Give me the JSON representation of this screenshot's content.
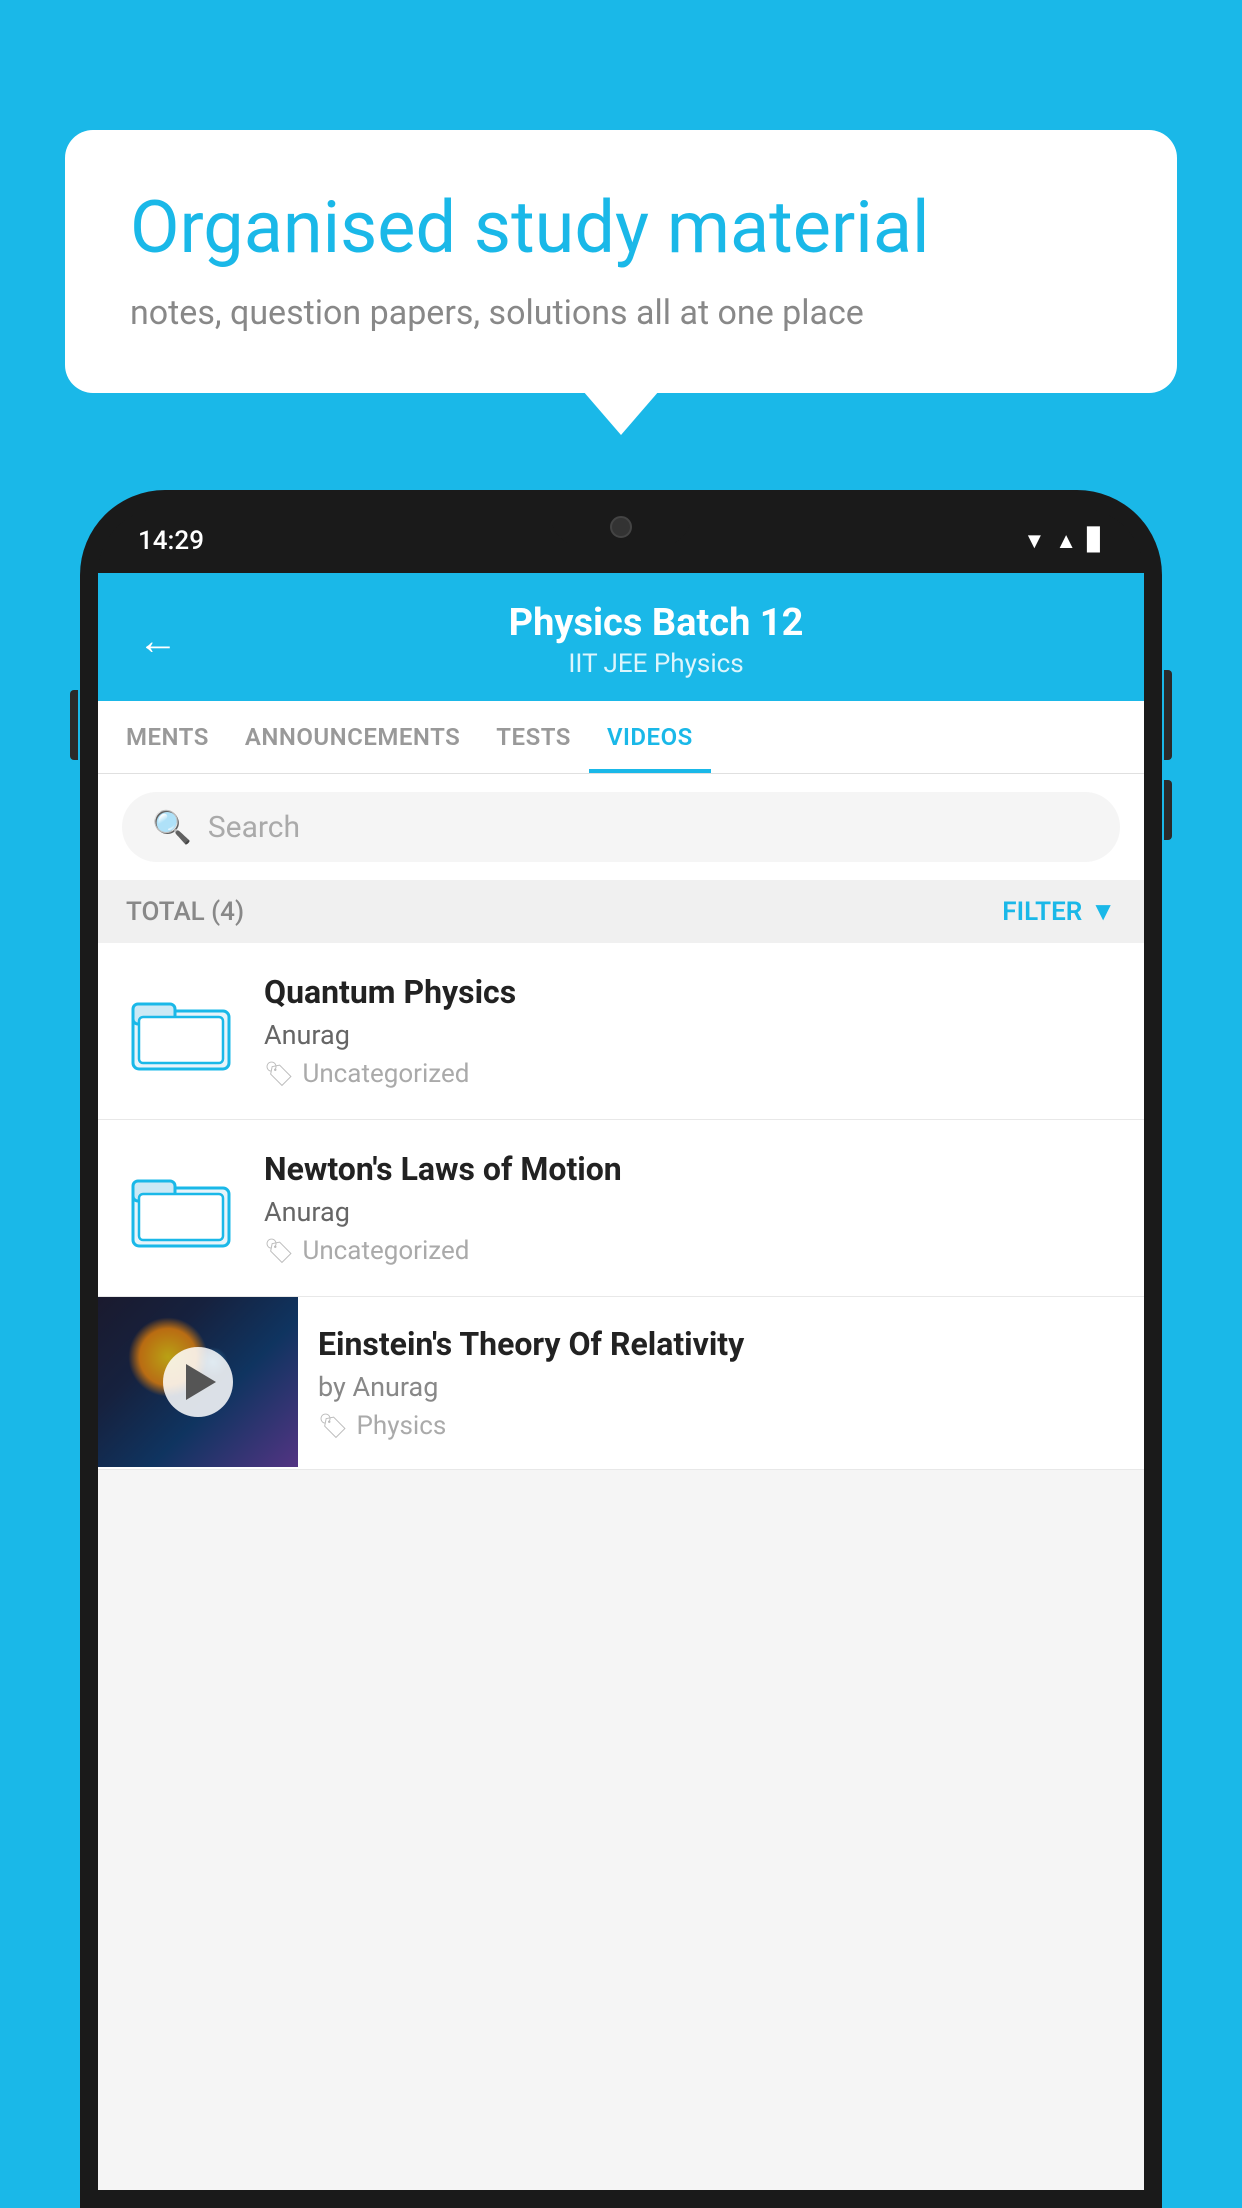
{
  "background": {
    "color": "#1ab8e8"
  },
  "speech_bubble": {
    "title": "Organised study material",
    "subtitle": "notes, question papers, solutions all at one place"
  },
  "phone": {
    "time": "14:29",
    "header": {
      "title": "Physics Batch 12",
      "subtitle": "IIT JEE   Physics",
      "back_label": "←"
    },
    "tabs": [
      {
        "label": "MENTS",
        "active": false
      },
      {
        "label": "ANNOUNCEMENTS",
        "active": false
      },
      {
        "label": "TESTS",
        "active": false
      },
      {
        "label": "VIDEOS",
        "active": true
      }
    ],
    "search": {
      "placeholder": "Search"
    },
    "filter_bar": {
      "total_label": "TOTAL (4)",
      "filter_label": "FILTER"
    },
    "videos": [
      {
        "title": "Quantum Physics",
        "author": "Anurag",
        "tag": "Uncategorized",
        "has_thumb": false
      },
      {
        "title": "Newton's Laws of Motion",
        "author": "Anurag",
        "tag": "Uncategorized",
        "has_thumb": false
      },
      {
        "title": "Einstein's Theory Of Relativity",
        "author": "by Anurag",
        "tag": "Physics",
        "has_thumb": true
      }
    ]
  }
}
